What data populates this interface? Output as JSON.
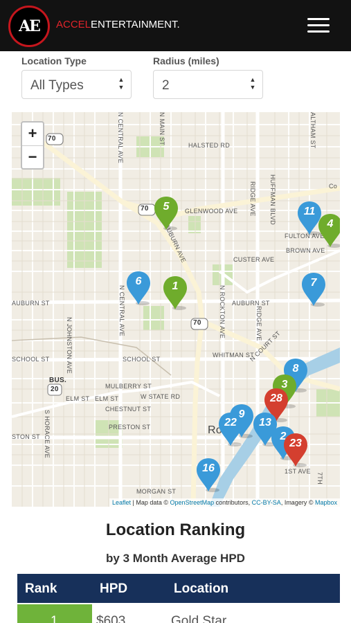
{
  "header": {
    "logo_text": "AE",
    "brand_accent": "ACCEL",
    "brand_rest": "ENTERTAINMENT",
    "brand_mark": ".",
    "menu_icon": "hamburger-icon"
  },
  "filters": {
    "location_type_label": "Location Type",
    "location_type_value": "All Types",
    "radius_label": "Radius (miles)",
    "radius_value": "2"
  },
  "map": {
    "zoom_in": "+",
    "zoom_out": "−",
    "attribution": {
      "leaflet": "Leaflet",
      "text1": " | Map data © ",
      "osm": "OpenStreetMap",
      "text2": " contributors, ",
      "license": "CC-BY-SA",
      "text3": ", Imagery © ",
      "mapbox": "Mapbox"
    },
    "street_labels": [
      "HALSTED RD",
      "N CENTRAL AVE",
      "N MAIN ST",
      "RIDGE AVE",
      "HUFFMAN BLVD",
      "ALTHAM ST",
      "GLENWOOD AVE",
      "FULTON AVE",
      "BROWN AVE",
      "CUSTER AVE",
      "AUBURN ST",
      "AUBURN ST",
      "N ROCKTON AVE",
      "N JOHNSTON AVE",
      "SCHOOL ST",
      "SCHOOL ST",
      "WHITMAN ST",
      "N COURT ST",
      "MULBERRY ST",
      "W STATE RD",
      "ELM ST",
      "ELM ST",
      "CHESTNUT ST",
      "PRESTON ST",
      "S HORACE AVE",
      "STON ST",
      "MORGAN ST",
      "1ST AVE",
      "7TH",
      "Ro",
      "Co",
      "AUBURN AVE",
      "N CENTRAL AVE",
      "RIDGE AVE",
      "BUS.",
      "70",
      "70",
      "70",
      "20"
    ],
    "markers": [
      {
        "label": "5",
        "color": "green"
      },
      {
        "label": "11",
        "color": "blue"
      },
      {
        "label": "4",
        "color": "green"
      },
      {
        "label": "6",
        "color": "blue"
      },
      {
        "label": "1",
        "color": "green"
      },
      {
        "label": "7",
        "color": "blue"
      },
      {
        "label": "8",
        "color": "blue"
      },
      {
        "label": "3",
        "color": "green"
      },
      {
        "label": "28",
        "color": "red"
      },
      {
        "label": "9",
        "color": "blue"
      },
      {
        "label": "22",
        "color": "blue"
      },
      {
        "label": "13",
        "color": "blue"
      },
      {
        "label": "2",
        "color": "blue"
      },
      {
        "label": "23",
        "color": "red"
      },
      {
        "label": "16",
        "color": "blue"
      }
    ],
    "colors": {
      "blue": "#3a9ad9",
      "green": "#6fac2c",
      "red": "#d43f2f"
    }
  },
  "ranking": {
    "title": "Location Ranking",
    "subtitle": "by 3 Month Average HPD",
    "columns": [
      "Rank",
      "HPD",
      "Location"
    ],
    "first_row": {
      "rank": "1",
      "hpd": "$603",
      "location": "Gold Star"
    }
  }
}
